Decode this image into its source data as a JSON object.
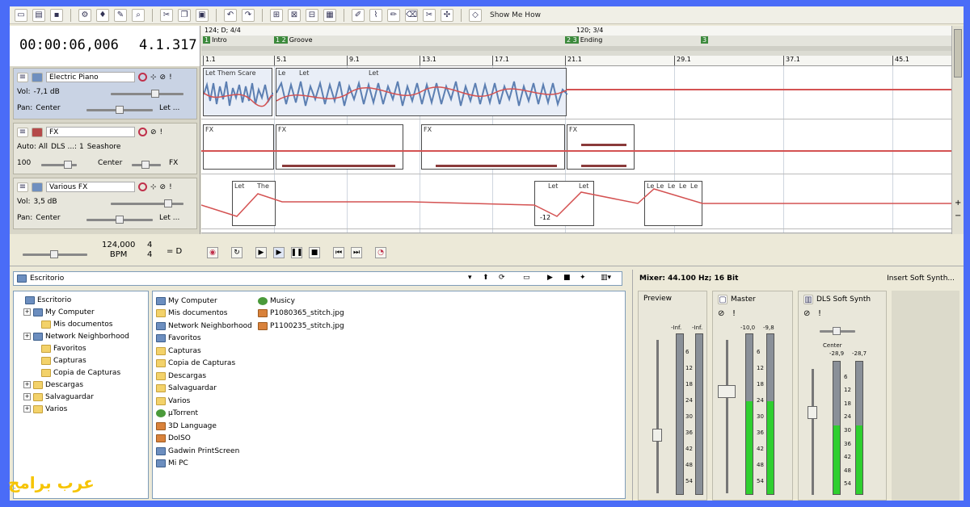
{
  "header": {
    "timecode": "00:00:06,006",
    "measure": "4.1.317",
    "show_me_how": "Show Me How",
    "tempo_markers": [
      "124; D; 4/4",
      "120; 3/4"
    ],
    "markers": [
      {
        "num": "1",
        "label": "Intro"
      },
      {
        "num": "1 2",
        "label": "Groove"
      },
      {
        "num": "2 3",
        "label": "Ending"
      },
      {
        "num": "3",
        "label": ""
      }
    ],
    "beats": [
      "1.1",
      "5.1",
      "9.1",
      "13.1",
      "17.1",
      "21.1",
      "29.1",
      "37.1",
      "45.1"
    ]
  },
  "tracks": [
    {
      "name": "Electric Piano",
      "row2_label": "Vol:",
      "row2_value": "-7,1 dB",
      "row3_label": "Pan:",
      "row3_value": "Center",
      "row3_extra": "Let ..."
    },
    {
      "name": "FX",
      "row2_label": "Auto: All",
      "row2_value": "DLS ...: 1",
      "row2_extra": "Seashore",
      "row3_label": "100",
      "row3_value": "Center",
      "row3_extra": "FX"
    },
    {
      "name": "Various FX",
      "row2_label": "Vol:",
      "row2_value": "3,5 dB",
      "row3_label": "Pan:",
      "row3_value": "Center",
      "row3_extra": "Let ..."
    }
  ],
  "events": {
    "piano_first": "Let Them Scare",
    "piano_short": "Le",
    "piano_let": "Let",
    "fx": "FX",
    "various_let": "Let",
    "various_the": "The",
    "various_val": "-12",
    "various_le": "Le"
  },
  "transport": {
    "bpm_value": "124,000",
    "bpm_label": "BPM",
    "time_sig_top": "4",
    "time_sig_bottom": "4",
    "key": "= D"
  },
  "explorer": {
    "address": "Escritorio",
    "tree": [
      {
        "label": "Escritorio",
        "indent": 0,
        "expand": ""
      },
      {
        "label": "My Computer",
        "indent": 1,
        "expand": "+"
      },
      {
        "label": "Mis documentos",
        "indent": 2,
        "expand": ""
      },
      {
        "label": "Network Neighborhood",
        "indent": 1,
        "expand": "+"
      },
      {
        "label": "Favoritos",
        "indent": 2,
        "expand": ""
      },
      {
        "label": "Capturas",
        "indent": 2,
        "expand": ""
      },
      {
        "label": "Copia de Capturas",
        "indent": 2,
        "expand": ""
      },
      {
        "label": "Descargas",
        "indent": 1,
        "expand": "+"
      },
      {
        "label": "Salvaguardar",
        "indent": 1,
        "expand": "+"
      },
      {
        "label": "Varios",
        "indent": 1,
        "expand": "+"
      }
    ],
    "files_col1": [
      {
        "label": "My Computer",
        "icon": "sysic"
      },
      {
        "label": "Mis documentos",
        "icon": "folder"
      },
      {
        "label": "Network Neighborhood",
        "icon": "sysic"
      },
      {
        "label": "Favoritos",
        "icon": "sysic"
      },
      {
        "label": "Capturas",
        "icon": "folder"
      },
      {
        "label": "Copia de Capturas",
        "icon": "folder"
      },
      {
        "label": "Descargas",
        "icon": "folder"
      },
      {
        "label": "Salvaguardar",
        "icon": "folder"
      },
      {
        "label": "Varios",
        "icon": "folder"
      },
      {
        "label": "µTorrent",
        "icon": "musicic"
      },
      {
        "label": "3D Language",
        "icon": "imgic"
      },
      {
        "label": "DoISO",
        "icon": "imgic"
      },
      {
        "label": "Gadwin PrintScreen",
        "icon": "sysic"
      },
      {
        "label": "Mi PC",
        "icon": "sysic"
      }
    ],
    "files_col2": [
      {
        "label": "Musicy",
        "icon": "musicic"
      },
      {
        "label": "P1080365_stitch.jpg",
        "icon": "imgic"
      },
      {
        "label": "P1100235_stitch.jpg",
        "icon": "imgic"
      }
    ]
  },
  "mixer": {
    "info": "Mixer: 44.100 Hz; 16 Bit",
    "insert": "Insert Soft Synth...",
    "preview": {
      "title": "Preview",
      "peak_l": "-Inf.",
      "peak_r": "-Inf.",
      "level_l": 0,
      "level_r": 0
    },
    "master": {
      "title": "Master",
      "peak_l": "-10,0",
      "peak_r": "-9,8",
      "level_l": 0.58,
      "level_r": 0.58
    },
    "dls": {
      "title": "DLS Soft Synth",
      "pan": "Center",
      "peak_l": "-28,9",
      "peak_r": "-28,7",
      "level_l": 0.52,
      "level_r": 0.52
    },
    "scale": [
      "6",
      "12",
      "18",
      "24",
      "30",
      "36",
      "42",
      "48",
      "54"
    ],
    "scale_short": [
      "6",
      "12",
      "18",
      "24",
      "30",
      "36",
      "42",
      "48",
      "54"
    ]
  },
  "watermark": "عرب برامج"
}
